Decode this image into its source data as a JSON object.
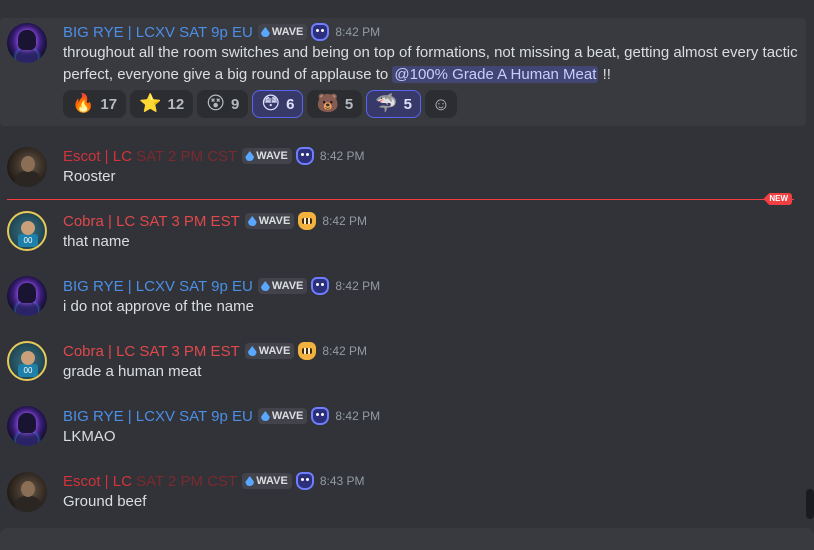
{
  "messages": [
    {
      "user": "BIG RYE | LCXV SAT 9p EU",
      "tag": "WAVE",
      "time": "8:42 PM",
      "text_before": "throughout all the room switches and being on top of formations, not missing a beat, getting almost every tactic perfect, everyone give a big round of applause to ",
      "mention": "@100% Grade A Human Meat",
      "text_after": " !!",
      "reactions": [
        {
          "emoji": "🔥",
          "count": "17",
          "icon": "fire-emoji",
          "me": false
        },
        {
          "emoji": "⭐",
          "count": "12",
          "icon": "star-emoji",
          "me": false
        },
        {
          "emoji": "😵",
          "count": "9",
          "icon": "dizzy-face-emoji",
          "me": false
        },
        {
          "emoji": "😳",
          "count": "6",
          "icon": "flushed-face-emoji",
          "me": true
        },
        {
          "emoji": "🐻",
          "count": "5",
          "icon": "shiro-sticker-emoji",
          "me": false
        },
        {
          "emoji": "🦈",
          "count": "5",
          "icon": "shark-emoji",
          "me": true
        }
      ],
      "add_reaction_icon": "add-reaction-icon"
    },
    {
      "user_main": "Escot | LC",
      "user_tail": " SAT 2 PM CST",
      "tag": "WAVE",
      "time": "8:42 PM",
      "text": "Rooster"
    },
    {
      "user": "Cobra | LC SAT 3 PM EST",
      "tag": "WAVE",
      "time": "8:42 PM",
      "text": "that name"
    },
    {
      "user": "BIG RYE | LCXV SAT 9p EU",
      "tag": "WAVE",
      "time": "8:42 PM",
      "text": "i do not approve of the name"
    },
    {
      "user": "Cobra | LC SAT 3 PM EST",
      "tag": "WAVE",
      "time": "8:42 PM",
      "text": "grade a human meat"
    },
    {
      "user": "BIG RYE | LCXV SAT 9p EU",
      "tag": "WAVE",
      "time": "8:42 PM",
      "text": "LKMAO"
    },
    {
      "user_main": "Escot | LC",
      "user_tail": " SAT 2 PM CST",
      "tag": "WAVE",
      "time": "8:43 PM",
      "text": "Ground beef"
    }
  ],
  "divider": {
    "label": "NEW"
  },
  "colors": {
    "rye": "#4c8fe6",
    "escot": "#d3323a",
    "cobra": "#e0484c",
    "background": "#313338"
  }
}
